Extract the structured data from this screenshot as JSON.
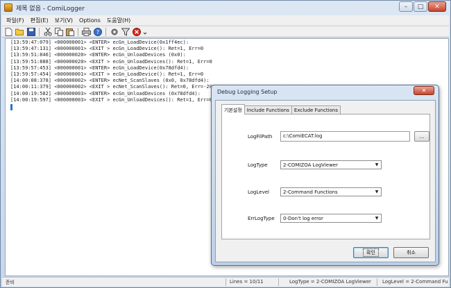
{
  "window": {
    "title": "제목 없음 - ComiLogger",
    "minimize": "–",
    "maximize": "□",
    "close": "✕"
  },
  "menu": [
    "파일(F)",
    "편집(E)",
    "보기(V)",
    "Options",
    "도움말(H)"
  ],
  "toolbar_icons": [
    "new-file-icon",
    "open-folder-icon",
    "save-icon",
    "cut-icon",
    "copy-icon",
    "paste-icon",
    "print-icon",
    "help-icon",
    "settings-icon",
    "filter-icon",
    "stop-icon"
  ],
  "log_lines": [
    "[13:59:47:079] <000000001> <ENTER> ecGn_LoadDevice(0x1ff4ec):",
    "[13:59:47:131] <000000001> <EXIT > ecGn_LoadDevice(): Ret=1, Err=0",
    "[13:59:51:846] <000000020> <ENTER> ecGn_UnloadDevices (0x0):",
    "[13:59:51:888] <000000020> <EXIT > ecGn_UnloadDevices(): Ret=1, Err=0",
    "[13:59:57:453] <000000001> <ENTER> ecGn_LoadDevice(0x78dfd4):",
    "[13:59:57:454] <000000001> <EXIT > ecGn_LoadDevice(): Ret=1, Err=0",
    "[14:00:08:378] <000000002> <ENTER> ecNet_ScanSlaves (0x0, 0x78dfd4):",
    "[14:00:11:379] <000000002> <EXIT > ecNet_ScanSlaves(): Ret=0, Err=-20210",
    "[14:00:19:582] <000000003> <ENTER> ecGn_UnloadDevices (0x78dfd4):",
    "[14:00:19:597] <000000003> <EXIT > ecGn_UnloadDevices(): Ret=1, Err=0"
  ],
  "status": {
    "ready": "준비",
    "lines": "Lines = 10/11",
    "logtype": "LogType = 2-COMIZOA LogViewer",
    "loglevel": "LogLevel = 2-Command Fu"
  },
  "dialog": {
    "title": "Debug Logging Setup",
    "close": "✕",
    "tabs": [
      "기본설정",
      "Include Functions",
      "Exclude Functions"
    ],
    "fields": {
      "logfilepath_label": "LogFilPath",
      "logfilepath_value": "c:\\ComiECAT.log",
      "browse_label": "...",
      "logtype_label": "LogType",
      "logtype_value": "2-COMIZOA LogViewer",
      "loglevel_label": "LogLevel",
      "loglevel_value": "2-Command Functions",
      "errlogtype_label": "ErrLogType",
      "errlogtype_value": "0-Don't log error"
    },
    "ok_label": "확인",
    "cancel_label": "취소"
  }
}
